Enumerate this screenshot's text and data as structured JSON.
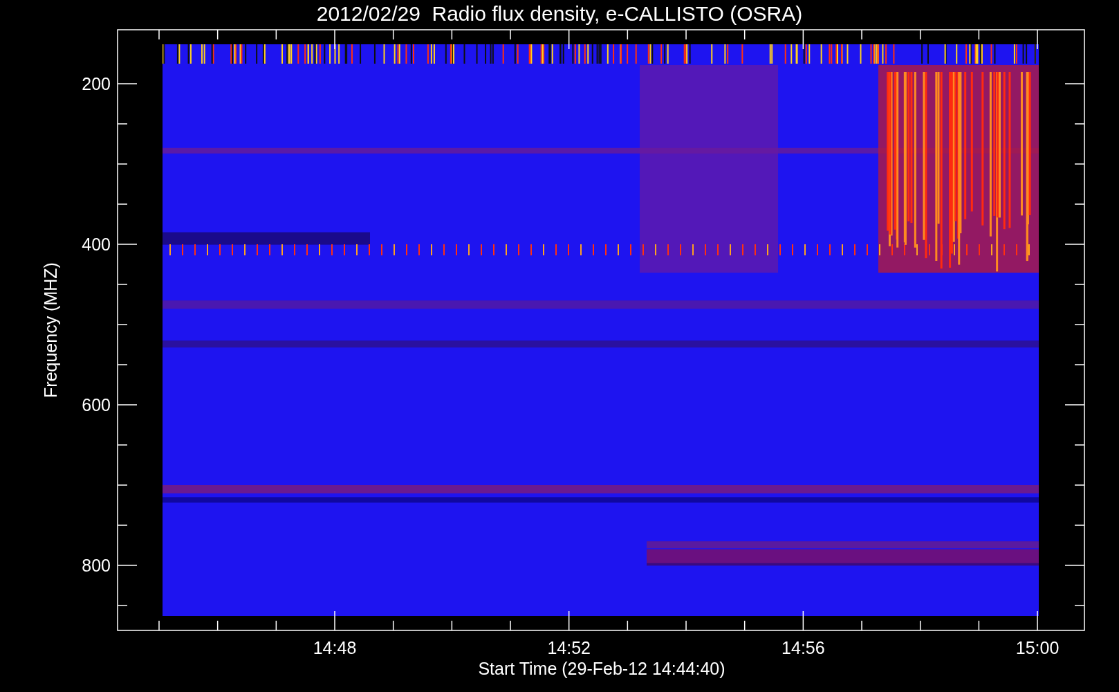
{
  "title": "2012/02/29  Radio flux density, e-CALLISTO (OSRA)",
  "y_axis": {
    "label": "Frequency (MHZ)",
    "ticks": [
      "200",
      "400",
      "600",
      "800"
    ]
  },
  "x_axis": {
    "label": "Start Time (29-Feb-12 14:44:40)",
    "ticks": [
      "14:48",
      "14:52",
      "14:56",
      "15:00"
    ]
  }
}
